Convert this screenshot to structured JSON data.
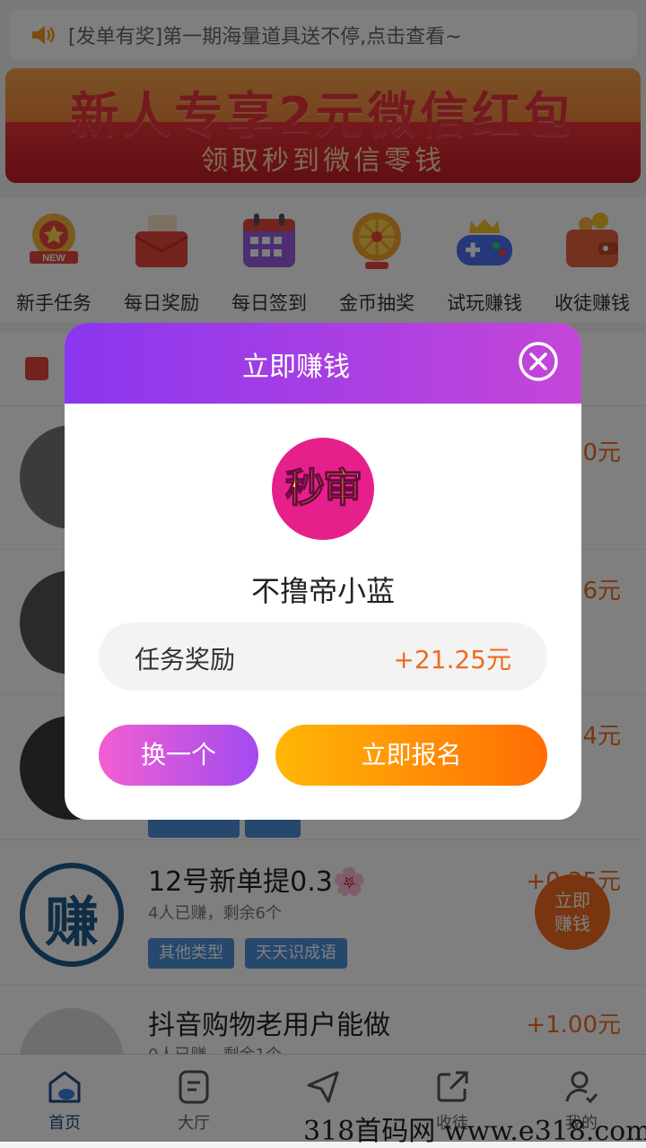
{
  "notice": {
    "text": "[发单有奖]第一期海量道具送不停,点击查看~"
  },
  "banner": {
    "title": "新人专享2元微信红包",
    "subtitle": "领取秒到微信零钱"
  },
  "features": [
    {
      "label": "新手任务",
      "icon": "new-badge-icon"
    },
    {
      "label": "每日奖励",
      "icon": "red-envelope-icon"
    },
    {
      "label": "每日签到",
      "icon": "calendar-icon"
    },
    {
      "label": "金币抽奖",
      "icon": "lottery-wheel-icon"
    },
    {
      "label": "试玩赚钱",
      "icon": "gamepad-icon"
    },
    {
      "label": "收徒赚钱",
      "icon": "wallet-icon"
    }
  ],
  "tasks": [
    {
      "price": "0元"
    },
    {
      "price": "6元"
    },
    {
      "price": "4元"
    },
    {
      "title": "12号新单提0.3🌸",
      "meta": "4人已赚，剩余6个",
      "tags": [
        "其他类型",
        "天天识成语"
      ],
      "price": "+0.35元"
    },
    {
      "title": "抖音购物老用户能做",
      "meta": "0人已赚，剩余1个",
      "price": "+1.00元"
    }
  ],
  "float_button": {
    "label": "立即赚钱"
  },
  "tabbar": [
    {
      "label": "首页",
      "active": true
    },
    {
      "label": "大厅"
    },
    {
      "label": ""
    },
    {
      "label": "收徒"
    },
    {
      "label": "我的"
    }
  ],
  "watermark": "318首码网 www.e318.com",
  "modal": {
    "title": "立即赚钱",
    "logo_text": "秒审",
    "task_name": "不撸帝小蓝",
    "reward_label": "任务奖励",
    "reward_value": "+21.25元",
    "swap_label": "换一个",
    "join_label": "立即报名"
  },
  "colors": {
    "accent_orange": "#f06b1f",
    "modal_purple": "#8a37ef",
    "join_orange": "#ff6d05"
  }
}
